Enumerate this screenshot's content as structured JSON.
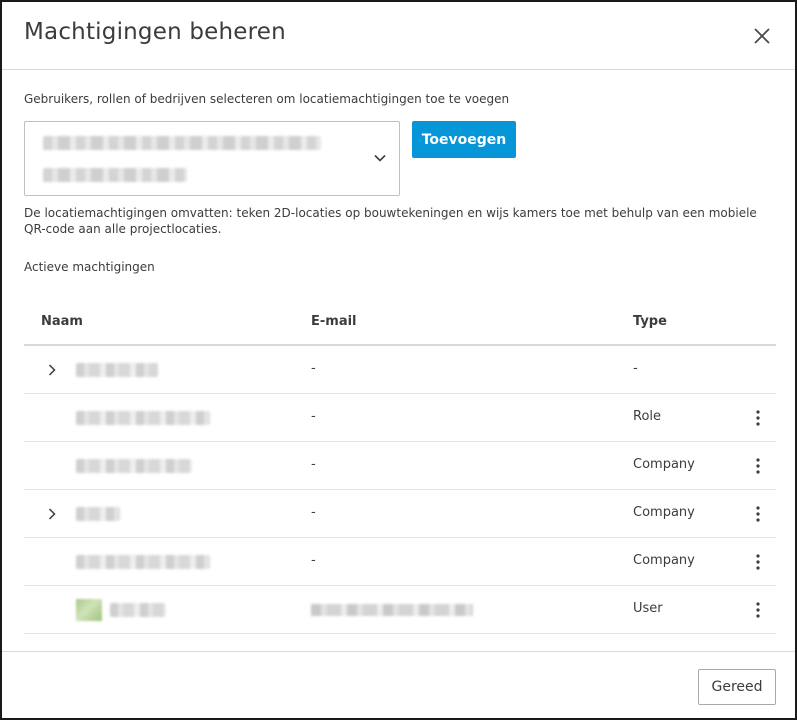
{
  "dialog": {
    "title": "Machtigingen beheren",
    "close_icon": "close-icon"
  },
  "form": {
    "instruction": "Gebruikers, rollen of bedrijven selecteren om locatiemachtigingen toe te voegen",
    "add_label": "Toevoegen",
    "info": "De locatiemachtigingen omvatten: teken 2D-locaties op bouwtekeningen en wijs kamers toe met behulp van een mobiele QR-code aan alle projectlocaties."
  },
  "permissions": {
    "section_label": "Actieve machtigingen",
    "columns": {
      "name": "Naam",
      "email": "E-mail",
      "type": "Type"
    },
    "rows": [
      {
        "email": "-",
        "type": "-",
        "expandable": true,
        "menu": false
      },
      {
        "email": "-",
        "type": "Role",
        "expandable": false,
        "menu": true
      },
      {
        "email": "-",
        "type": "Company",
        "expandable": false,
        "menu": true
      },
      {
        "email": "-",
        "type": "Company",
        "expandable": true,
        "menu": true
      },
      {
        "email": "-",
        "type": "Company",
        "expandable": false,
        "menu": true
      },
      {
        "email": "",
        "type": "User",
        "expandable": false,
        "menu": true
      }
    ]
  },
  "footer": {
    "done_label": "Gereed"
  },
  "colors": {
    "accent": "#0696d7",
    "text": "#3c3c3c",
    "border": "#d9d9d9"
  }
}
